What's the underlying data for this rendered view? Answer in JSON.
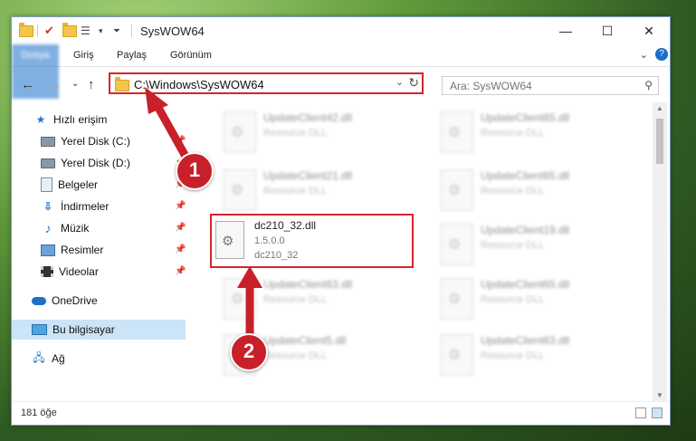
{
  "window": {
    "title": "SysWOW64",
    "min": "—",
    "max": "☐",
    "close": "✕"
  },
  "ribbon": {
    "tabs": [
      "Dosya",
      "Giriş",
      "Paylaş",
      "Görünüm"
    ],
    "expand": "⌄",
    "help": "?"
  },
  "nav": {
    "back": "←",
    "forward": "→",
    "recent": "⌄",
    "up": "↑",
    "address": "C:\\Windows\\SysWOW64",
    "search_placeholder": "Ara: SysWOW64"
  },
  "sidebar": {
    "items": [
      {
        "label": "Hızlı erişim",
        "icon": "star-icon"
      },
      {
        "label": "Yerel Disk (C:)",
        "icon": "disk-icon"
      },
      {
        "label": "Yerel Disk (D:)",
        "icon": "disk-icon"
      },
      {
        "label": "Belgeler",
        "icon": "documents-icon"
      },
      {
        "label": "İndirmeler",
        "icon": "download-icon"
      },
      {
        "label": "Müzik",
        "icon": "music-icon"
      },
      {
        "label": "Resimler",
        "icon": "pictures-icon"
      },
      {
        "label": "Videolar",
        "icon": "videos-icon"
      },
      {
        "label": "OneDrive",
        "icon": "cloud-icon"
      },
      {
        "label": "Bu bilgisayar",
        "icon": "computer-icon"
      },
      {
        "label": "Ağ",
        "icon": "network-icon"
      }
    ]
  },
  "files": [
    {
      "name": "UpdateClient42.dll",
      "desc": "Resource DLL"
    },
    {
      "name": "UpdateClient65.dll",
      "desc": "Resource DLL"
    },
    {
      "name": "UpdateClient21.dll",
      "desc": "Resource DLL"
    },
    {
      "name": "UpdateClient65.dll",
      "desc": "Resource DLL"
    },
    {
      "name": "UpdateClient19.dll",
      "desc": "Resource DLL"
    },
    {
      "name": "UpdateClient63.dll",
      "desc": "Resource DLL"
    },
    {
      "name": "UpdateClient65.dll",
      "desc": "Resource DLL"
    },
    {
      "name": "UpdateClient5.dll",
      "desc": "Resource DLL"
    },
    {
      "name": "UpdateClient63.dll",
      "desc": "Resource DLL"
    }
  ],
  "highlighted_file": {
    "name": "dc210_32.dll",
    "version": "1.5.0.0",
    "description": "dc210_32"
  },
  "status": {
    "count": "181 öğe"
  },
  "annotations": {
    "step1": "1",
    "step2": "2"
  },
  "colors": {
    "accent": "#1a6fc9",
    "highlight_border": "#d3262a",
    "badge": "#c8202a"
  }
}
